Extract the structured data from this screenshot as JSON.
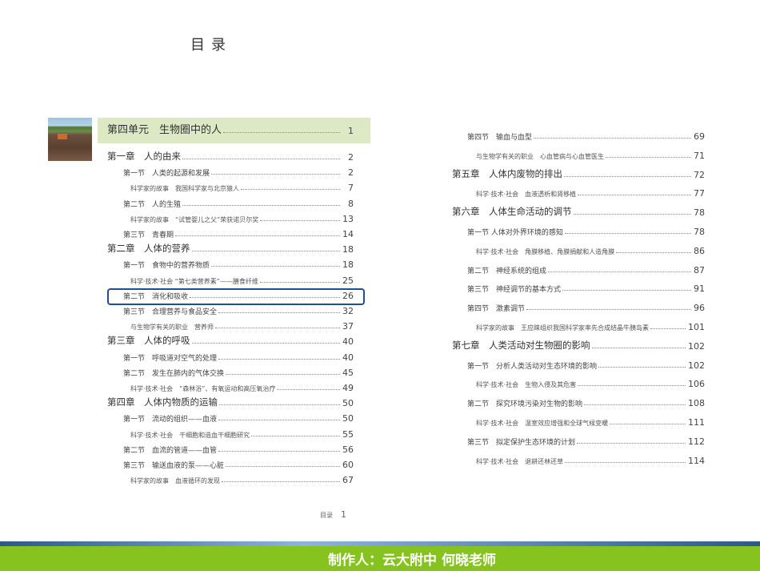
{
  "title": "目录",
  "unit": {
    "label": "第四单元　生物圈中的人",
    "page": "1"
  },
  "left": [
    {
      "level": 1,
      "label": "第一章　人的由来",
      "page": "2"
    },
    {
      "level": 2,
      "label": "第一节　人类的起源和发展",
      "page": "2"
    },
    {
      "level": 3,
      "label": "科学家的故事　我国科学家与北京猿人",
      "page": "7"
    },
    {
      "level": 2,
      "label": "第二节　人的生殖",
      "page": "8"
    },
    {
      "level": 3,
      "label": "科学家的故事　“试管婴儿之父”荣获诺贝尔奖",
      "page": "13"
    },
    {
      "level": 2,
      "label": "第三节　青春期",
      "page": "14"
    },
    {
      "level": 1,
      "label": "第二章　人体的营养",
      "page": "18"
    },
    {
      "level": 2,
      "label": "第一节　食物中的营养物质",
      "page": "18"
    },
    {
      "level": 3,
      "label": "科学·技术·社会 “第七类营养素”——膳食纤维",
      "page": "25"
    },
    {
      "level": 2,
      "label": "第二节　消化和吸收",
      "page": "26",
      "highlight": true
    },
    {
      "level": 2,
      "label": "第三节　合理营养与食品安全",
      "page": "32"
    },
    {
      "level": 3,
      "label": "与生物学有关的职业　营养师",
      "page": "37"
    },
    {
      "level": 1,
      "label": "第三章　人体的呼吸",
      "page": "40"
    },
    {
      "level": 2,
      "label": "第一节　呼吸道对空气的处理",
      "page": "40"
    },
    {
      "level": 2,
      "label": "第二节　发生在肺内的气体交换",
      "page": "45"
    },
    {
      "level": 3,
      "label": "科学·技术·社会　“森林浴”、有氧运动和高压氧治疗",
      "page": "49"
    },
    {
      "level": 1,
      "label": "第四章　人体内物质的运输",
      "page": "50"
    },
    {
      "level": 2,
      "label": "第一节　流动的组织——血液",
      "page": "50"
    },
    {
      "level": 3,
      "label": "科学·技术·社会　干细胞和造血干细胞研究",
      "page": "55"
    },
    {
      "level": 2,
      "label": "第二节　血流的管道——血管",
      "page": "56"
    },
    {
      "level": 2,
      "label": "第三节　输送血液的泵——心脏",
      "page": "60"
    },
    {
      "level": 3,
      "label": "科学家的故事　血液循环的发现",
      "page": "67"
    }
  ],
  "right": [
    {
      "level": 2,
      "label": "第四节　输血与血型",
      "page": "69"
    },
    {
      "level": 3,
      "label": "与生物学有关的职业　心血管病与心血管医生",
      "page": "71"
    },
    {
      "level": 1,
      "label": "第五章　人体内废物的排出",
      "page": "72"
    },
    {
      "level": 3,
      "label": "科学·技术·社会　血液透析和肾移植",
      "page": "77"
    },
    {
      "level": 1,
      "label": "第六章　人体生命活动的调节",
      "page": "78"
    },
    {
      "level": 2,
      "label": "第一节 人体对外界环境的感知",
      "page": "78"
    },
    {
      "level": 3,
      "label": "科学·技术·社会　角膜移植、角膜捐献和人造角膜",
      "page": "86"
    },
    {
      "level": 2,
      "label": "第二节　神经系统的组成",
      "page": "87"
    },
    {
      "level": 2,
      "label": "第三节　神经调节的基本方式",
      "page": "91"
    },
    {
      "level": 2,
      "label": "第四节　激素调节",
      "page": "96"
    },
    {
      "level": 3,
      "label": "科学家的故事　王应睐组织我国科学家率先合成结晶牛胰岛素",
      "page": "101"
    },
    {
      "level": 1,
      "label": "第七章　人类活动对生物圈的影响",
      "page": "102"
    },
    {
      "level": 2,
      "label": "第一节　分析人类活动对生态环境的影响",
      "page": "102"
    },
    {
      "level": 3,
      "label": "科学·技术·社会　生物入侵及其危害",
      "page": "106"
    },
    {
      "level": 2,
      "label": "第二节　探究环境污染对生物的影响",
      "page": "108"
    },
    {
      "level": 3,
      "label": "科学·技术·社会　温室效应增强和全球气候变暖",
      "page": "111"
    },
    {
      "level": 2,
      "label": "第三节　拟定保护生态环境的计划",
      "page": "112"
    },
    {
      "level": 3,
      "label": "科学·技术·社会　退耕还林还草",
      "page": "114"
    }
  ],
  "footer": {
    "label": "目录",
    "page": "1"
  },
  "banner": "制作人：云大附中 何晓老师"
}
